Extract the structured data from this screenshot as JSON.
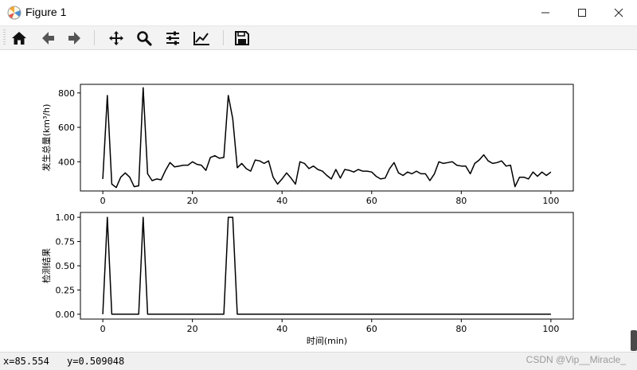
{
  "window": {
    "title": "Figure 1"
  },
  "toolbar": {
    "buttons": [
      {
        "name": "home-icon",
        "tip": "Home"
      },
      {
        "name": "back-icon",
        "tip": "Back"
      },
      {
        "name": "forward-icon",
        "tip": "Forward"
      },
      {
        "name": "pan-icon",
        "tip": "Pan"
      },
      {
        "name": "zoom-icon",
        "tip": "Zoom"
      },
      {
        "name": "subplots-icon",
        "tip": "Subplots"
      },
      {
        "name": "customize-icon",
        "tip": "Customize"
      },
      {
        "name": "save-icon",
        "tip": "Save"
      }
    ]
  },
  "status": {
    "x_readout": "x=85.554",
    "y_readout": "y=0.509048",
    "watermark": "CSDN @Vip__Miracle_"
  },
  "colors": {
    "line": "#000000",
    "toolbar_bg": "#f3f3f3",
    "status_bg": "#f0f0f0"
  },
  "chart_data": [
    {
      "type": "line",
      "xlabel": "",
      "ylabel": "发生总量(km³/h)",
      "ylim": [
        230,
        850
      ],
      "xlim": [
        -5,
        105
      ],
      "x_ticks": [
        0,
        20,
        40,
        60,
        80,
        100
      ],
      "y_ticks": [
        400,
        600,
        800
      ],
      "x_tick_labels": [
        "0",
        "20",
        "40",
        "60",
        "80",
        "100"
      ],
      "y_tick_labels": [
        "400",
        "600",
        "800"
      ],
      "series": [
        {
          "x": [
            0,
            1,
            2,
            3,
            4,
            5,
            6,
            7,
            8,
            9,
            10,
            11,
            12,
            13,
            14,
            15,
            16,
            17,
            18,
            19,
            20,
            21,
            22,
            23,
            24,
            25,
            26,
            27,
            28,
            29,
            30,
            31,
            32,
            33,
            34,
            35,
            36,
            37,
            38,
            39,
            40,
            41,
            42,
            43,
            44,
            45,
            46,
            47,
            48,
            49,
            50,
            51,
            52,
            53,
            54,
            55,
            56,
            57,
            58,
            59,
            60,
            61,
            62,
            63,
            64,
            65,
            66,
            67,
            68,
            69,
            70,
            71,
            72,
            73,
            74,
            75,
            76,
            77,
            78,
            79,
            80,
            81,
            82,
            83,
            84,
            85,
            86,
            87,
            88,
            89,
            90,
            91,
            92,
            93,
            94,
            95,
            96,
            97,
            98,
            99,
            100
          ],
          "y": [
            300,
            785,
            270,
            250,
            310,
            335,
            310,
            255,
            260,
            830,
            330,
            290,
            300,
            295,
            350,
            395,
            370,
            375,
            380,
            380,
            400,
            385,
            380,
            350,
            425,
            435,
            420,
            425,
            785,
            650,
            365,
            390,
            360,
            345,
            410,
            405,
            390,
            405,
            310,
            270,
            300,
            335,
            305,
            270,
            400,
            390,
            360,
            375,
            355,
            345,
            320,
            300,
            355,
            305,
            355,
            350,
            340,
            355,
            345,
            345,
            340,
            315,
            300,
            305,
            360,
            395,
            335,
            320,
            340,
            330,
            345,
            330,
            330,
            290,
            330,
            400,
            390,
            395,
            400,
            380,
            375,
            375,
            330,
            390,
            410,
            440,
            405,
            390,
            395,
            405,
            375,
            380,
            255,
            310,
            310,
            300,
            340,
            315,
            340,
            320,
            340
          ]
        }
      ]
    },
    {
      "type": "line",
      "xlabel": "时间(min)",
      "ylabel": "检测结果",
      "ylim": [
        -0.05,
        1.05
      ],
      "xlim": [
        -5,
        105
      ],
      "x_ticks": [
        0,
        20,
        40,
        60,
        80,
        100
      ],
      "y_ticks": [
        0.0,
        0.25,
        0.5,
        0.75,
        1.0
      ],
      "x_tick_labels": [
        "0",
        "20",
        "40",
        "60",
        "80",
        "100"
      ],
      "y_tick_labels": [
        "0.00",
        "0.25",
        "0.50",
        "0.75",
        "1.00"
      ],
      "series": [
        {
          "x": [
            0,
            1,
            2,
            8,
            9,
            10,
            27,
            28,
            29,
            30,
            100
          ],
          "y": [
            0,
            1,
            0,
            0,
            1,
            0,
            0,
            1,
            1,
            0,
            0
          ]
        }
      ]
    }
  ]
}
